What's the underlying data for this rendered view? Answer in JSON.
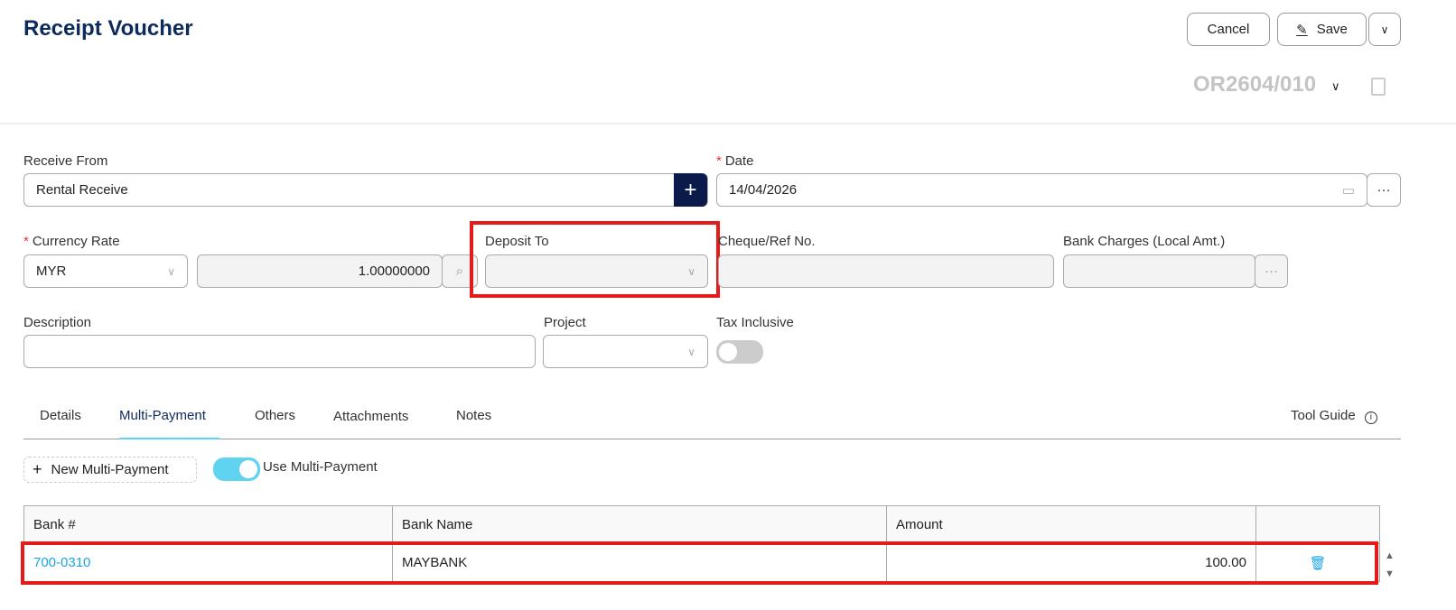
{
  "header": {
    "title": "Receipt Voucher",
    "cancel": "Cancel",
    "save": "Save",
    "doc_no": "OR2604/010"
  },
  "form": {
    "receive_from_label": "Receive From",
    "receive_from_value": "Rental Receive",
    "date_label": "Date",
    "date_value": "14/04/2026",
    "currency_rate_label": "Currency Rate",
    "currency_value": "MYR",
    "rate_value": "1.00000000",
    "deposit_to_label": "Deposit To",
    "deposit_to_value": "",
    "cheque_label": "Cheque/Ref No.",
    "cheque_value": "",
    "bank_charges_label": "Bank Charges (Local Amt.)",
    "bank_charges_value": "",
    "description_label": "Description",
    "description_value": "",
    "project_label": "Project",
    "project_value": "",
    "tax_inclusive_label": "Tax Inclusive",
    "tax_inclusive_on": false
  },
  "tabs": [
    {
      "label": "Details"
    },
    {
      "label": "Multi-Payment",
      "active": true
    },
    {
      "label": "Others"
    },
    {
      "label": "Attachments"
    },
    {
      "label": "Notes"
    }
  ],
  "tool_guide": "Tool Guide",
  "multi_payment": {
    "new_label": "New Multi-Payment",
    "use_label": "Use Multi-Payment",
    "use_on": true,
    "columns": [
      "Bank #",
      "Bank Name",
      "Amount"
    ],
    "rows": [
      {
        "bank_no": "700-0310",
        "bank_name": "MAYBANK",
        "amount": "100.00"
      }
    ]
  },
  "colors": {
    "title": "#0d2a5c",
    "accent": "#5fd3f0",
    "link": "#1aa3e8",
    "highlight": "#e31b1b"
  }
}
